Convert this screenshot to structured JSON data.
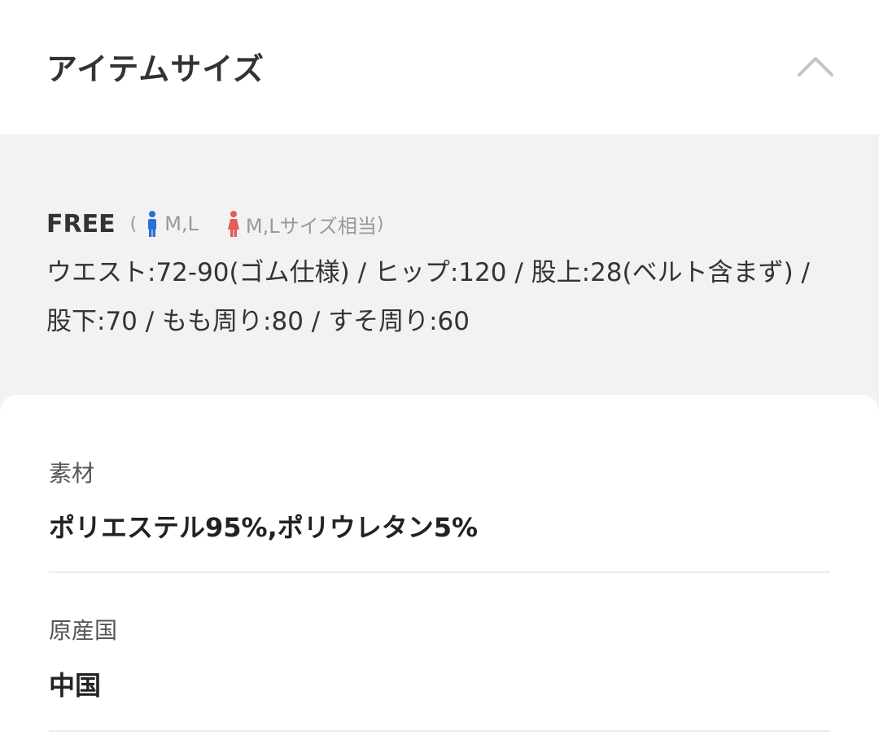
{
  "header": {
    "title": "アイテムサイズ",
    "collapse_icon": "chevron-up-icon"
  },
  "size_info": {
    "size_name": "FREE",
    "paren_open": "(",
    "paren_close": ")",
    "male_icon": "male-person-icon",
    "male_color": "#2a6fd6",
    "male_sizes": "M,L",
    "female_icon": "female-person-icon",
    "female_color": "#e35b5b",
    "female_sizes": "M,Lサイズ相当",
    "description": "ウエスト:72-90(ゴム仕様) / ヒップ:120 / 股上:28(ベルト含まず) / 股下:70 / もも周り:80 / すそ周り:60"
  },
  "details": [
    {
      "label": "素材",
      "value": "ポリエステル95%,ポリウレタン5%"
    },
    {
      "label": "原産国",
      "value": "中国"
    }
  ]
}
